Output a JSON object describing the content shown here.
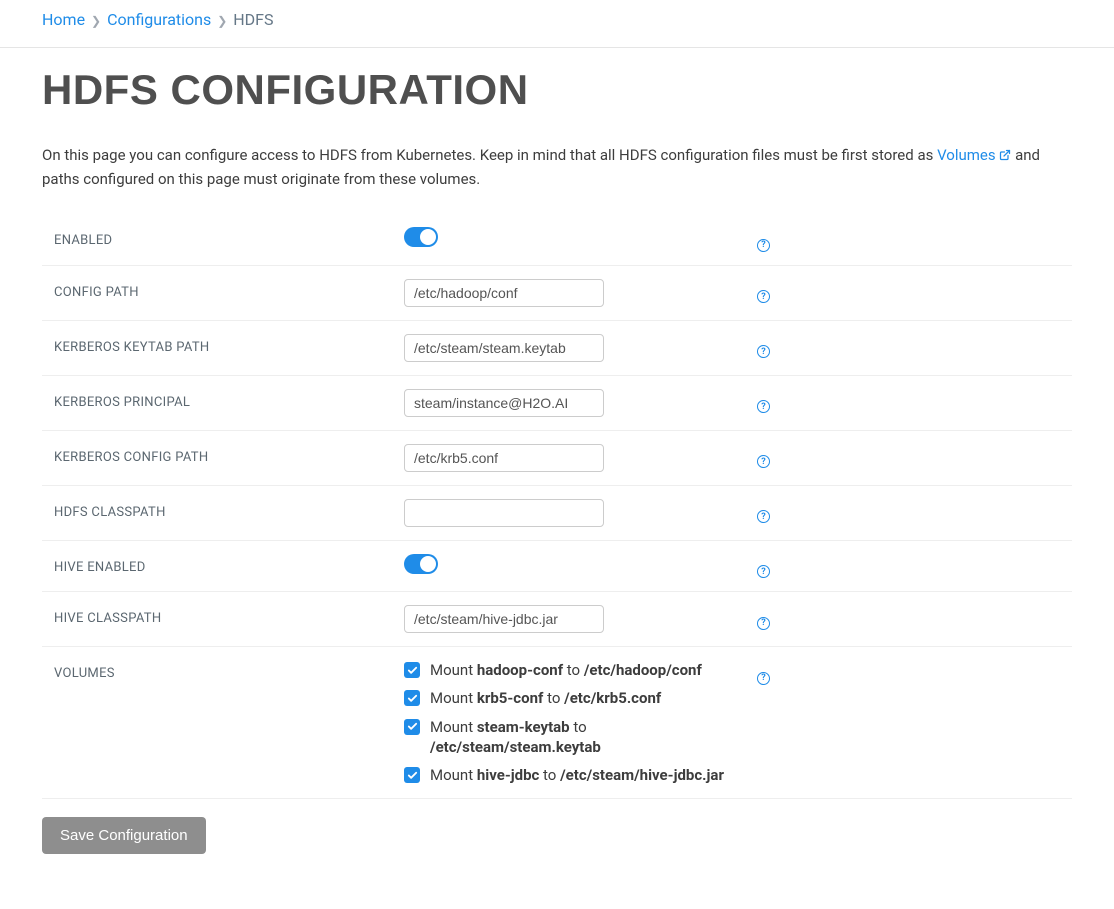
{
  "breadcrumb": {
    "home": "Home",
    "configurations": "Configurations",
    "current": "HDFS"
  },
  "page_title": "HDFS CONFIGURATION",
  "intro": {
    "prefix": "On this page you can configure access to HDFS from Kubernetes. Keep in mind that all HDFS configuration files must be first stored as ",
    "link_text": "Volumes",
    "suffix": " and paths configured on this page must originate from these volumes."
  },
  "labels": {
    "enabled": "ENABLED",
    "config_path": "CONFIG PATH",
    "kerberos_keytab_path": "KERBEROS KEYTAB PATH",
    "kerberos_principal": "KERBEROS PRINCIPAL",
    "kerberos_config_path": "KERBEROS CONFIG PATH",
    "hdfs_classpath": "HDFS CLASSPATH",
    "hive_enabled": "HIVE ENABLED",
    "hive_classpath": "HIVE CLASSPATH",
    "volumes": "VOLUMES"
  },
  "values": {
    "enabled": true,
    "config_path": "/etc/hadoop/conf",
    "kerberos_keytab_path": "/etc/steam/steam.keytab",
    "kerberos_principal": "steam/instance@H2O.AI",
    "kerberos_config_path": "/etc/krb5.conf",
    "hdfs_classpath": "",
    "hive_enabled": true,
    "hive_classpath": "/etc/steam/hive-jdbc.jar"
  },
  "volumes": [
    {
      "checked": true,
      "prefix": "Mount ",
      "name": "hadoop-conf",
      "mid": " to ",
      "path": "/etc/hadoop/conf"
    },
    {
      "checked": true,
      "prefix": "Mount ",
      "name": "krb5-conf",
      "mid": " to ",
      "path": "/etc/krb5.conf"
    },
    {
      "checked": true,
      "prefix": "Mount ",
      "name": "steam-keytab",
      "mid": " to ",
      "path": "/etc/steam/steam.keytab"
    },
    {
      "checked": true,
      "prefix": "Mount ",
      "name": "hive-jdbc",
      "mid": " to ",
      "path": "/etc/steam/hive-jdbc.jar"
    }
  ],
  "save_button": "Save Configuration"
}
